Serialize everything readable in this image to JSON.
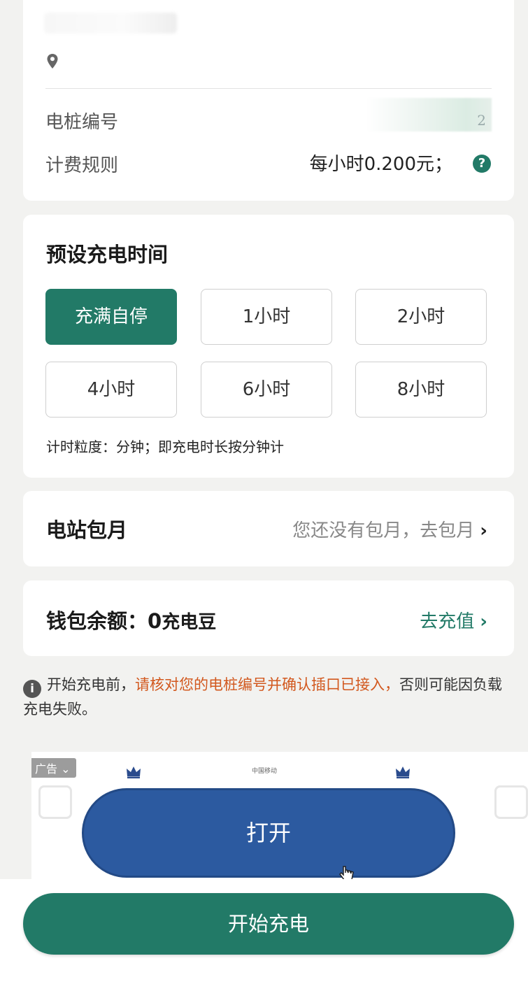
{
  "station_info": {
    "pile_number_label": "电桩编号",
    "pile_number_value": "2",
    "billing_rule_label": "计费规则",
    "billing_rule_value": "每小时0.200元；",
    "help_icon": "?"
  },
  "preset_time": {
    "title": "预设充电时间",
    "options": [
      "充满自停",
      "1小时",
      "2小时",
      "4小时",
      "6小时",
      "8小时"
    ],
    "selected": "充满自停",
    "note": "计时粒度：分钟；即充电时长按分钟计"
  },
  "monthly": {
    "label": "电站包月",
    "link": "您还没有包月，去包月"
  },
  "wallet": {
    "label_prefix": "钱包余额：",
    "balance": "0",
    "unit": "充电豆",
    "recharge": "去充值"
  },
  "notice": {
    "icon": "i",
    "part1": "开始充电前，",
    "warning": "请核对您的电桩编号并确认插口已接入，",
    "part2": "否则可能因负载充电失败。"
  },
  "ad": {
    "tag": "广告",
    "tag_chevron": "⌄",
    "logo_text": "中国移动",
    "button": "打开"
  },
  "start_button": "开始充电",
  "colors": {
    "accent": "#227a67",
    "warning": "#d2581e",
    "ad_button": "#2c5aa0"
  }
}
